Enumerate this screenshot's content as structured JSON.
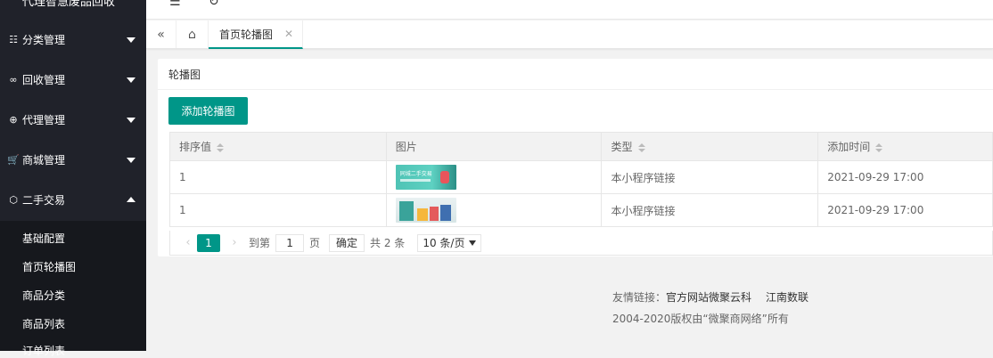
{
  "sidebar": {
    "top_title": "代理智慧废品回收",
    "menus": [
      {
        "icon": "category-icon",
        "glyph": "☷",
        "label": "分类管理",
        "expanded": false
      },
      {
        "icon": "recycle-icon",
        "glyph": "∞",
        "label": "回收管理",
        "expanded": false
      },
      {
        "icon": "agent-icon",
        "glyph": "⊕",
        "label": "代理管理",
        "expanded": false
      },
      {
        "icon": "cart-icon",
        "glyph": "🛒",
        "label": "商城管理",
        "expanded": false
      },
      {
        "icon": "box-icon",
        "glyph": "⬡",
        "label": "二手交易",
        "expanded": true
      }
    ],
    "submenu": [
      "基础配置",
      "首页轮播图",
      "商品分类",
      "商品列表",
      "订单列表"
    ]
  },
  "topbar": {
    "menu_glyph": "☰",
    "refresh_glyph": "↻"
  },
  "tabs": {
    "prev_glyph": "«",
    "home_glyph": "⌂",
    "active_label": "首页轮播图",
    "close_glyph": "✕"
  },
  "card": {
    "title": "轮播图",
    "add_button": "添加轮播图",
    "table": {
      "headers": [
        "排序值",
        "图片",
        "类型",
        "添加时间"
      ],
      "rows": [
        {
          "sort": "1",
          "image_text": "同城二手交易",
          "type": "本小程序链接",
          "time": "2021-09-29 17:00"
        },
        {
          "sort": "1",
          "image_text": "",
          "type": "本小程序链接",
          "time": "2021-09-29 17:00"
        }
      ]
    },
    "pager": {
      "prev": "‹",
      "current": "1",
      "next": "›",
      "goto_label": "到第",
      "goto_value": "1",
      "page_label": "页",
      "confirm": "确定",
      "total": "共 2 条",
      "page_size": "10 条/页"
    }
  },
  "footer": {
    "links_label": "友情链接：",
    "link1": "官方网站微聚云科",
    "link2": "江南数联",
    "copyright": "2004-2020版权由“微聚商网络”所有"
  },
  "colors": {
    "accent": "#009688",
    "sidebar_bg": "#20222a",
    "submenu_bg": "#16181d"
  }
}
